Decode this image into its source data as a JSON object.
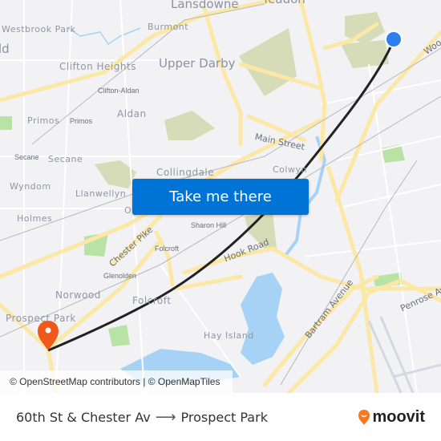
{
  "map": {
    "labels": {
      "lansdowne": "Lansdowne",
      "yeadon": "Yeadon",
      "westbrook_park": "Westbrook Park",
      "burmont": "Burmont",
      "partial_left": "ld",
      "clifton_heights": "Clifton Heights",
      "upper_darby": "Upper Darby",
      "clifton_aldan": "Clifton-Aldan",
      "aldan": "Aldan",
      "primos_town": "Primos",
      "primos_station": "Primos",
      "secane_station": "Secane",
      "secane_town": "Secane",
      "main_street": "Main Street",
      "collingdale": "Collingdale",
      "colwyn": "Colwyn",
      "wyndom": "Wyndom",
      "llanwellyn": "Llanwellyn",
      "holmes": "Holmes",
      "partial_o": "O",
      "sharon_hill": "Sharon Hill",
      "chester_pike": "Chester Pike",
      "folcroft_station": "Folcroft",
      "hook_road": "Hook Road",
      "glenolden": "Glenolden",
      "norwood": "Norwood",
      "folcroft_town": "Folcroft",
      "prospect_park": "Prospect Park",
      "hay_island": "Hay Island",
      "bartram_avenue": "Bartram Avenue",
      "penrose_avenue": "Penrose Av",
      "woodland": "Woo"
    },
    "origin_marker_color": "#2d7ff0",
    "destination_marker_color": "#f0581c",
    "route_color": "#222222"
  },
  "cta": {
    "label": "Take me there",
    "color": "#0073d6"
  },
  "attribution": "© OpenStreetMap contributors | © OpenMapTiles",
  "footer": {
    "origin": "60th St & Chester Av",
    "arrow": "⟶",
    "destination": "Prospect Park",
    "brand": "moovit",
    "brand_color": "#f47920"
  }
}
